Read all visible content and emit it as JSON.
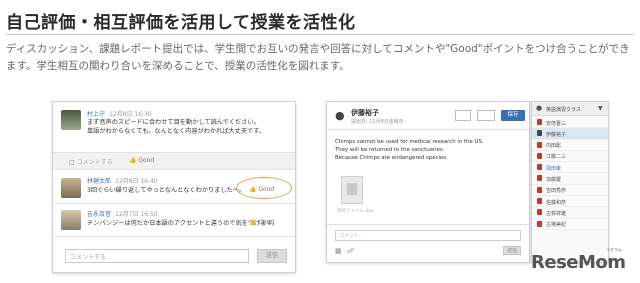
{
  "page": {
    "title": "自己評価・相互評価を活用して授業を活性化",
    "description": "ディスカッション、課題レポート提出では、学生間でお互いの発言や回答に対してコメントや\"Good\"ポイントをつけ合うことができます。学生相互の関わり合いを深めることで、授業の活性化を図れます。"
  },
  "discussion": {
    "posts": [
      {
        "name": "村上守",
        "time": "12月8日 16:30",
        "lines": [
          "まず音声のスピードに合わせて目を動かして読んでください。",
          "単語がわからなくても、なんとなく内容がわかれば大丈夫です。"
        ]
      },
      {
        "name": "林健太郎",
        "time": "12月8日 16:40",
        "lines": [
          "3回ぐらい繰り返してやっとなんとなくわかりました～。"
        ]
      },
      {
        "name": "吉永百音",
        "time": "12月7日 16:50",
        "lines": [
          "チンパンジーは何だか日本語のアクセントと違うので気をつけます。"
        ]
      }
    ],
    "comment_action": "コメントする",
    "good_label": "Good",
    "comment_placeholder": "コメントする...",
    "send_label": "送信"
  },
  "report": {
    "student_name": "伊藤裕子",
    "submitted": "提出日: 12月8日金曜日",
    "save_label": "保存",
    "lines": [
      "Chimps cannot be used for medical research in the US.",
      "They will be returned to the sanctuaries.",
      "Because Chimps are endangered species."
    ],
    "attachment_caption": "添付ファイル.doc",
    "comment_placeholder": "コメント...",
    "send_label": "送信"
  },
  "roster": {
    "class_name": "英語演習クラス",
    "students": [
      "安倍晋三",
      "伊藤裕子",
      "内田聡",
      "江藤二三",
      "岡田孝",
      "加藤慶",
      "吉田秀彦",
      "佐藤和彦",
      "古賀祥雄",
      "古場美紀"
    ],
    "selected_index": 1
  },
  "brand": {
    "logo": "ReseMom",
    "logo_sub": "リセマム"
  }
}
